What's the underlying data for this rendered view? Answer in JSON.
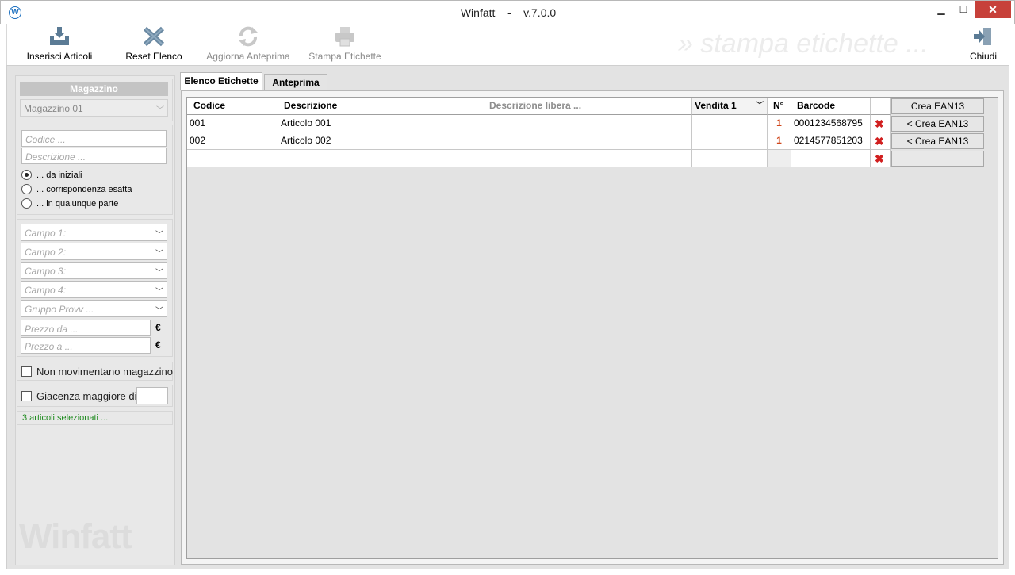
{
  "window": {
    "title": "Winfatt    -    v.7.0.0",
    "app_icon": "W",
    "minimize": "▁",
    "maximize": "☐",
    "close": "✕"
  },
  "toolbar": {
    "buttons": [
      {
        "label": "Inserisci Articoli",
        "icon": "tray-download-icon",
        "enabled": true
      },
      {
        "label": "Reset Elenco",
        "icon": "reset-x-icon",
        "enabled": true
      },
      {
        "label": "Aggiorna Anteprima",
        "icon": "refresh-icon",
        "enabled": false
      },
      {
        "label": "Stampa Etichette",
        "icon": "printer-icon",
        "enabled": false
      }
    ],
    "watermark": "» stampa etichette ...",
    "close_label": "Chiudi",
    "close_icon": "exit-door-icon"
  },
  "left_panel": {
    "warehouse_header": "Magazzino",
    "warehouse_value": "Magazzino 01",
    "code_placeholder": "Codice ...",
    "description_placeholder": "Descrizione ...",
    "search_modes": [
      {
        "label": "... da iniziali",
        "checked": true
      },
      {
        "label": "... corrispondenza esatta",
        "checked": false
      },
      {
        "label": "... in qualunque parte",
        "checked": false
      }
    ],
    "fields": [
      "Campo 1:",
      "Campo 2:",
      "Campo 3:",
      "Campo 4:",
      "Gruppo Provv ..."
    ],
    "price_from_placeholder": "Prezzo da ...",
    "price_to_placeholder": "Prezzo a ...",
    "currency": "€",
    "non_movement_label": "Non movimentano magazzino",
    "stock_greater_label": "Giacenza maggiore di:",
    "selection_status": "3 articoli selezionati ...",
    "logo": "Winfatt"
  },
  "tabs": [
    {
      "label": "Elenco Etichette",
      "active": true
    },
    {
      "label": "Anteprima",
      "active": false
    }
  ],
  "grid": {
    "columns": {
      "code": "Codice",
      "description": "Descrizione",
      "free_description": "Descrizione libera ...",
      "price": "Vendita 1",
      "qty": "N°",
      "barcode": "Barcode",
      "action": "Crea EAN13"
    },
    "rows": [
      {
        "code": "001",
        "description": "Articolo 001",
        "free_description": "",
        "price": "",
        "qty": "1",
        "barcode": "0001234568795",
        "action": "< Crea EAN13"
      },
      {
        "code": "002",
        "description": "Articolo 002",
        "free_description": "",
        "price": "",
        "qty": "1",
        "barcode": "0214577851203",
        "action": "< Crea EAN13"
      },
      {
        "code": "",
        "description": "",
        "free_description": "",
        "price": "",
        "qty": "",
        "barcode": "",
        "action": ""
      }
    ],
    "delete_icon": "✖"
  }
}
